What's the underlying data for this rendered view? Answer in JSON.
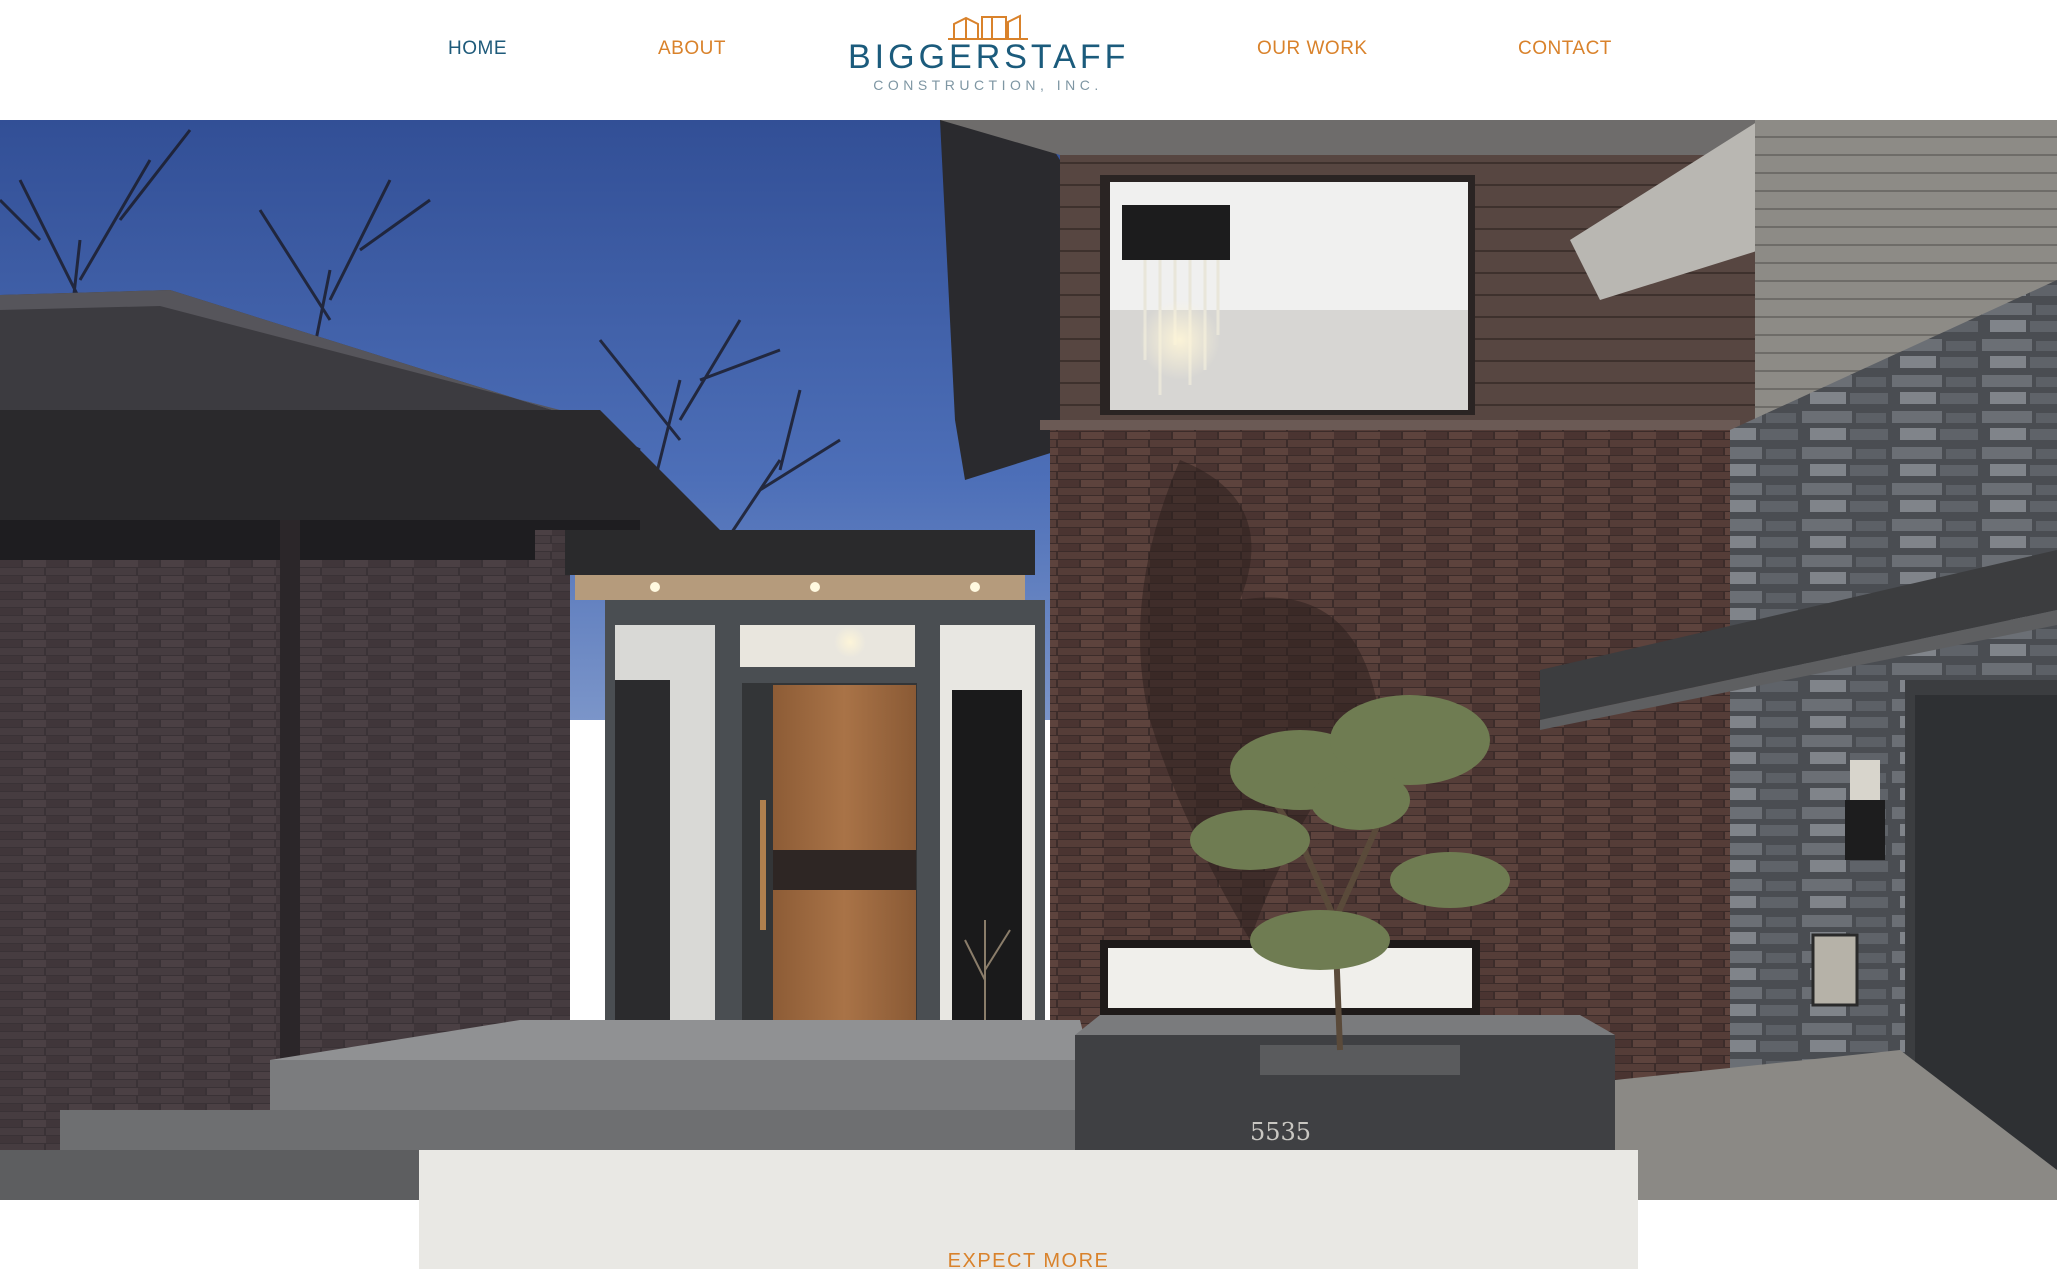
{
  "nav": {
    "home": "HOME",
    "about": "ABOUT",
    "our_work": "OUR WORK",
    "contact": "CONTACT"
  },
  "logo": {
    "name": "BIGGERSTAFF",
    "subtitle": "CONSTRUCTION, INC.",
    "icon": "house-outline-icon"
  },
  "hero": {
    "house_number": "5535",
    "image_subject": "modern-house-exterior-photo"
  },
  "card": {
    "title": "EXPECT MORE"
  },
  "colors": {
    "nav_active": "#1e5a7a",
    "nav_accent": "#d9822b",
    "brand_blue": "#1b5b7c",
    "card_bg": "#e9e8e4"
  }
}
